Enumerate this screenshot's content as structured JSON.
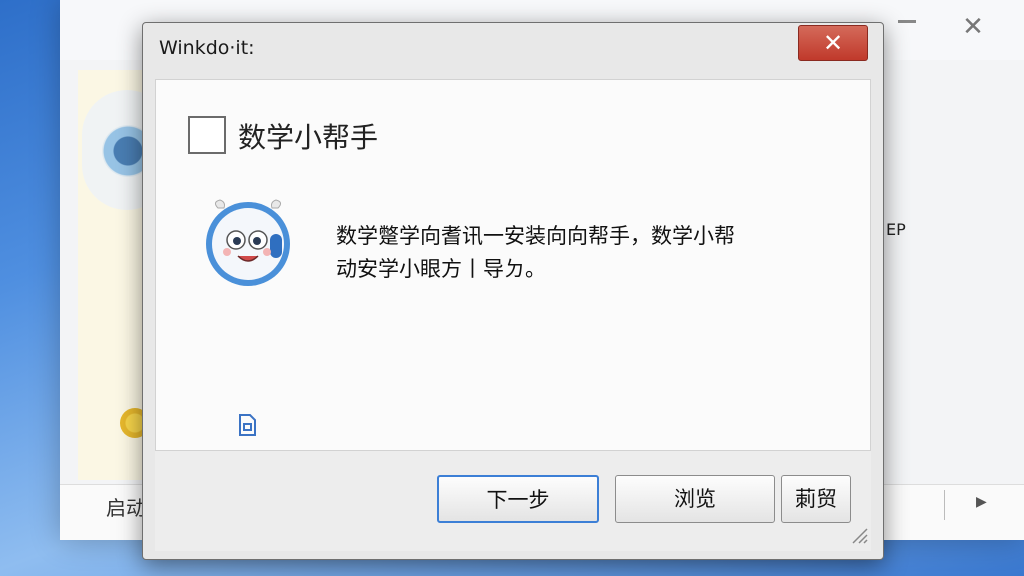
{
  "background_window": {
    "close_glyph": "✕",
    "bottom_label": "启动",
    "right_text": "EP",
    "scroll_arrow": "▶"
  },
  "dialog": {
    "title": "Winkdo·it:",
    "close_glyph": "✕",
    "header_title": "数学小帮手",
    "header_checked": false,
    "message_lines": [
      "数学蹩学向耆讯一安装向向帮手，数学小帮",
      "动安学小眼方丨导ㄉ。"
    ],
    "buttons": {
      "next": "下一步",
      "browse": "浏览",
      "cancel": "莿贸"
    }
  },
  "icons": {
    "mascot": "mascot-avatar-icon",
    "document": "document-icon",
    "resize": "resize-grip-icon"
  },
  "colors": {
    "close_button": "#c0392b",
    "default_button_border": "#3c7fd6",
    "mascot_ring": "#4a90d9"
  }
}
